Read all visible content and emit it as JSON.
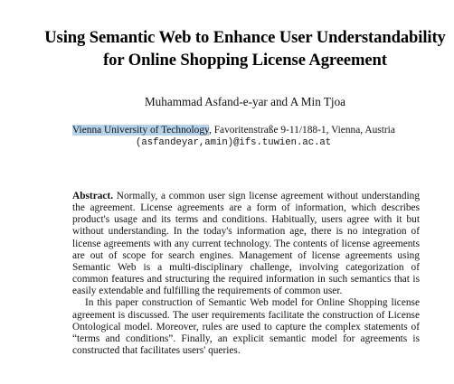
{
  "paper": {
    "title_line1": "Using Semantic Web to Enhance User Understandability",
    "title_line2": "for Online Shopping License Agreement",
    "authors": "Muhammad Asfand-e-yar and A Min Tjoa",
    "affiliation_highlight": "Vienna University of Technology",
    "affiliation_rest": ", Favoritenstraße 9-11/188-1, Vienna, Austria",
    "emails": "(asfandeyar,amin)@ifs.tuwien.ac.at",
    "abstract_label": "Abstract.",
    "abstract_p1": "Normally, a common user sign license agreement without understanding the agreement. License agreements are a form of information, which describes product's usage and its terms and conditions. Habitually, users agree with it but without understanding. In the today's information age, there is no integration of license agreements with any current technology. The contents of license agreements are out of scope for search engines. Management of license agreements using Semantic Web is a multi-disciplinary challenge, involving categorization of common features and structuring the required information in such semantics that is easily extendable and fulfilling the requirements of common user.",
    "abstract_p2": "In this paper construction of Semantic Web model for Online Shopping license agreement is discussed. The user requirements facilitate the construction of License Ontological model. Moreover, rules are used to capture the complex statements of “terms and conditions”. Finally, an explicit semantic model for agreements is constructed that facilitates users' queries."
  },
  "colors": {
    "highlight": "#b7d3ec",
    "text": "#111111"
  }
}
